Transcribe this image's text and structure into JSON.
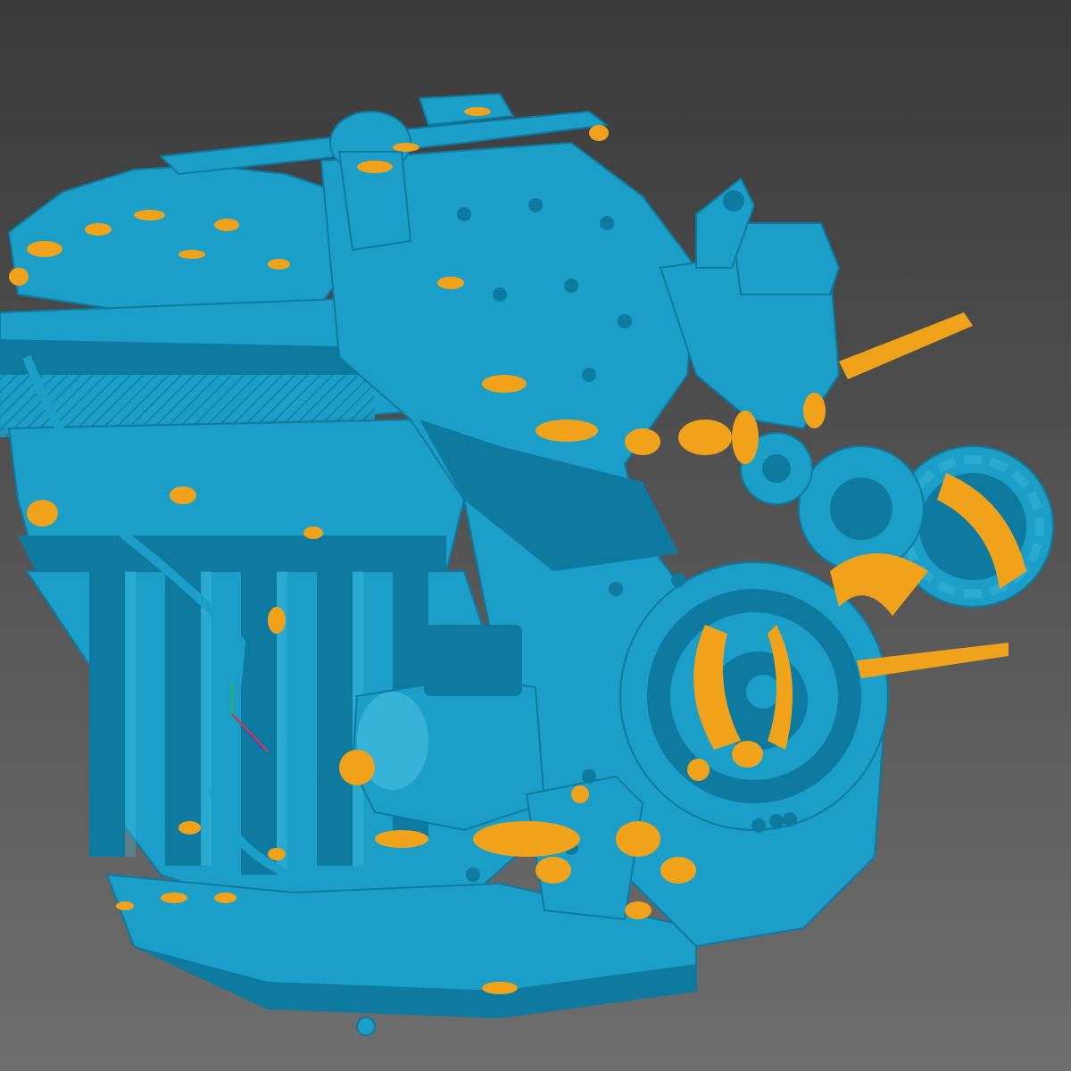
{
  "viewport": {
    "background_top": "#3a3a3a",
    "background_bottom": "#6e6e6e",
    "mesh_color": "#1b9ec8",
    "mesh_shade": "#0f7aa0",
    "mesh_highlight": "#4cc3e6",
    "deviation_color": "#f0a21a",
    "deviation_shade": "#c98310"
  },
  "axis_gizmo": {
    "x_color": "#3b46d8",
    "y_color": "#2fb84a",
    "z_color": "#d83b3b"
  }
}
